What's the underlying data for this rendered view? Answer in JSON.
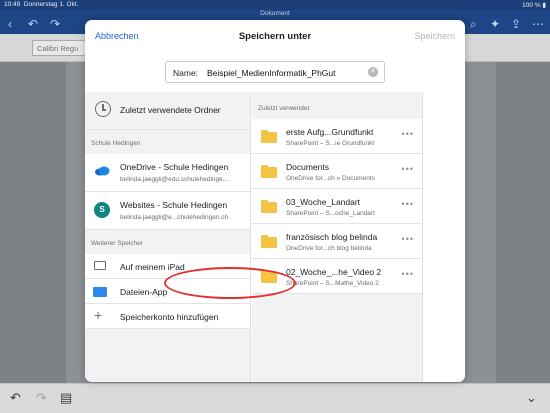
{
  "status_bar": {
    "time": "10:49",
    "date": "Donnerstag 1. Okt.",
    "battery": "100 %"
  },
  "document": {
    "title": "Dokument",
    "font_name": "Calibri Regu"
  },
  "dialog": {
    "cancel_label": "Abbrechen",
    "title": "Speichern unter",
    "save_label": "Speichern",
    "name_label": "Name:",
    "name_value": "Beispiel_MedienInformatik_PhGut"
  },
  "left_pane": {
    "recent_label": "Zuletzt verwendete Ordner",
    "section_school": "Schule Hedingen",
    "locations": [
      {
        "title": "OneDrive - Schule Hedingen",
        "subtitle": "belinda.jaeggli@edu.schulehedinge..."
      },
      {
        "title": "Websites - Schule Hedingen",
        "subtitle": "belinda.jaeggli@e...chulehedingen.ch"
      }
    ],
    "section_other": "Weiterer Speicher",
    "other": [
      {
        "title": "Auf meinem iPad"
      },
      {
        "title": "Dateien-App"
      },
      {
        "title": "Speicherkonto hinzufügen"
      }
    ]
  },
  "right_pane": {
    "section_label": "Zuletzt verwendet",
    "files": [
      {
        "name": "erste Aufg...Grundfunkt",
        "path": "SharePoint – S...ie Grundfunkt"
      },
      {
        "name": "Documents",
        "path": "OneDrive for...ch » Documents"
      },
      {
        "name": "03_Woche_Landart",
        "path": "SharePoint – S...oche_Landart"
      },
      {
        "name": "französisch blog belinda",
        "path": "OneDrive for...ch blog belinda"
      },
      {
        "name": "02_Woche_...he_Video 2",
        "path": "SharePoint – S...Mathe_Video 2"
      }
    ]
  },
  "colors": {
    "accent": "#2466c9",
    "highlight_circle": "#e2302b",
    "folder": "#f6c444",
    "ribbon": "#1e4585"
  }
}
